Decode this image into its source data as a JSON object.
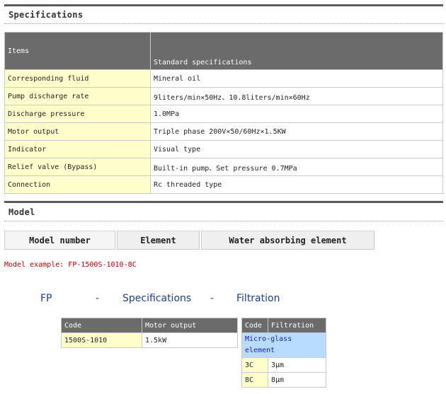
{
  "specifications": {
    "title": "Specifications",
    "header": {
      "items": "Items",
      "standard": "Standard specifications"
    },
    "rows": [
      {
        "item": "Corresponding fluid",
        "value": "Mineral oil"
      },
      {
        "item": "Pump discharge rate",
        "value": "9liters/min×50Hz、10.8liters/min×60Hz"
      },
      {
        "item": "Discharge pressure",
        "value": "1.0MPa"
      },
      {
        "item": "Motor output",
        "value": "Triple phase 200V×50/60Hz×1.5KW"
      },
      {
        "item": "Indicator",
        "value": "Visual type"
      },
      {
        "item": "Relief valve (Bypass)",
        "value": "Built-in pump、Set pressure 0.7MPa"
      },
      {
        "item": "Connection",
        "value": "Rc threaded type"
      }
    ]
  },
  "model": {
    "title": "Model",
    "tabs": [
      {
        "label": "Model number"
      },
      {
        "label": "Element"
      },
      {
        "label": "Water absorbing element"
      }
    ],
    "example": "Model example: FP-1500S-1010-8C",
    "code_parts": [
      "FP",
      "-",
      "Specifications",
      "-",
      "Filtration"
    ],
    "spec_table": {
      "headers": [
        "Code",
        "Motor output"
      ],
      "rows": [
        {
          "code": "1500S-1010",
          "motor": "1.5kW"
        }
      ]
    },
    "filtration_table": {
      "headers": [
        "Code",
        "Filtration"
      ],
      "group_label": "Micro-glass element",
      "rows": [
        {
          "code": "3C",
          "filtration": "3μm"
        },
        {
          "code": "8C",
          "filtration": "8μm"
        }
      ]
    }
  }
}
